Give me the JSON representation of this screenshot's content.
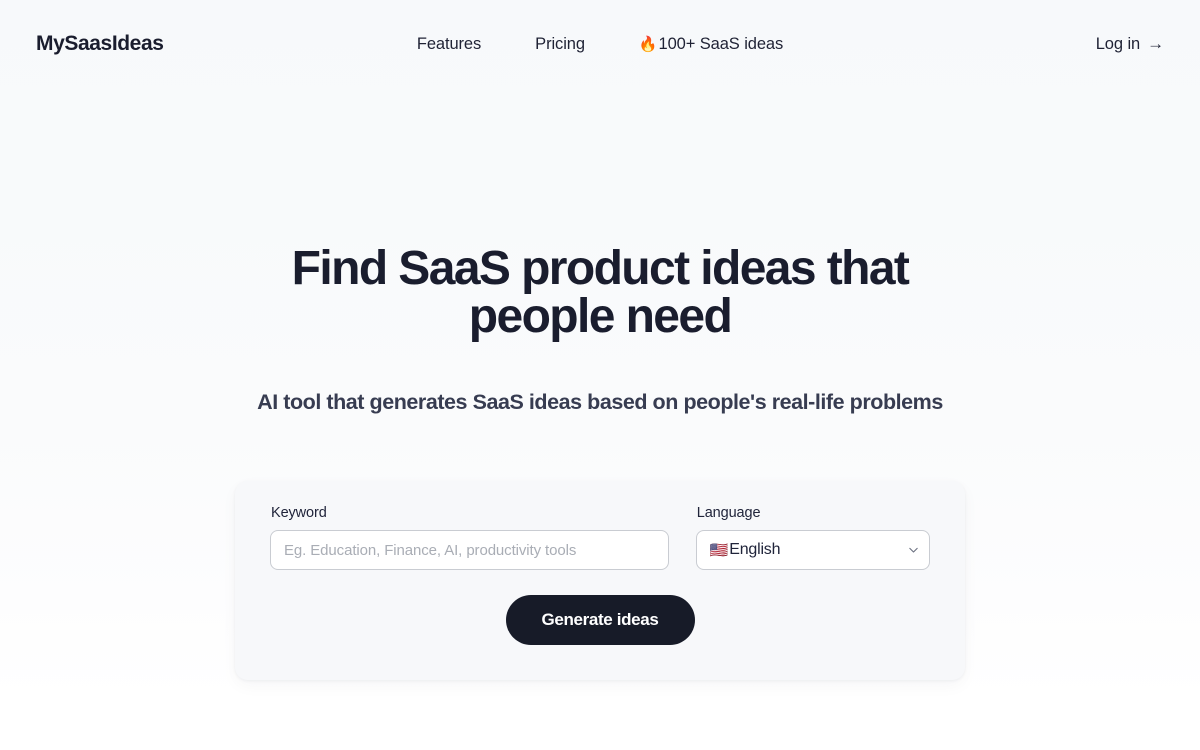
{
  "header": {
    "brand": "MySaasIdeas",
    "nav": [
      {
        "label": "Features"
      },
      {
        "label": "Pricing"
      }
    ],
    "nav_highlight": {
      "emoji": "🔥",
      "label": "100+ SaaS ideas"
    },
    "login": {
      "label": "Log in",
      "arrow": "→"
    }
  },
  "hero": {
    "title": "Find SaaS product ideas that people need",
    "subtitle": "AI tool that generates SaaS ideas based on people's real-life problems"
  },
  "form": {
    "keyword": {
      "label": "Keyword",
      "placeholder": "Eg. Education, Finance, AI, productivity tools",
      "value": ""
    },
    "language": {
      "label": "Language",
      "flag": "🇺🇸",
      "selected": "English",
      "options": [
        "English"
      ]
    },
    "submit_label": "Generate ideas"
  },
  "colors": {
    "page_background_top": "#f7f9fb",
    "page_background_bottom": "#ffffff",
    "card_background": "#f7f8fa",
    "heading": "#1a1d2e",
    "subtitle": "#373c51",
    "button_background": "#171b28",
    "button_text": "#ffffff",
    "input_border": "#c9ccd2",
    "placeholder": "#a9adb5"
  }
}
